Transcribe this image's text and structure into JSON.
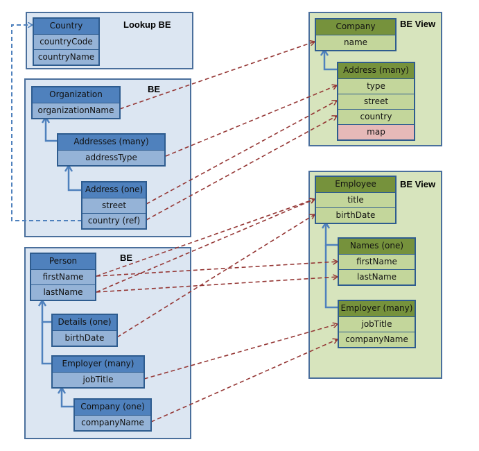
{
  "containers": {
    "lookup": {
      "title": "Lookup BE"
    },
    "org": {
      "title": "BE"
    },
    "person": {
      "title": "BE"
    },
    "company_view": {
      "title": "BE View"
    },
    "employee_view": {
      "title": "BE View"
    }
  },
  "entities": {
    "country": {
      "header": "Country",
      "fields": [
        "countryCode",
        "countryName"
      ]
    },
    "organization": {
      "header": "Organization",
      "fields": [
        "organizationName"
      ]
    },
    "addresses": {
      "header": "Addresses (many)",
      "fields": [
        "addressType"
      ]
    },
    "address_one": {
      "header": "Address (one)",
      "fields": [
        "street",
        "country (ref)"
      ]
    },
    "person": {
      "header": "Person",
      "fields": [
        "firstName",
        "lastName"
      ]
    },
    "details": {
      "header": "Details (one)",
      "fields": [
        "birthDate"
      ]
    },
    "employer": {
      "header": "Employer (many)",
      "fields": [
        "jobTitle"
      ]
    },
    "company_one": {
      "header": "Company (one)",
      "fields": [
        "companyName"
      ]
    },
    "v_company": {
      "header": "Company",
      "fields": [
        "name"
      ]
    },
    "v_address": {
      "header": "Address (many)",
      "fields": [
        "type",
        "street",
        "country",
        "map"
      ]
    },
    "v_employee": {
      "header": "Employee",
      "fields": [
        "title",
        "birthDate"
      ]
    },
    "v_names": {
      "header": "Names (one)",
      "fields": [
        "firstName",
        "lastName"
      ]
    },
    "v_employer": {
      "header": "Employer (many)",
      "fields": [
        "jobTitle",
        "companyName"
      ]
    }
  },
  "colors": {
    "be_background": "#dce6f2",
    "view_background": "#d7e4bd",
    "be_header": "#4f81bd",
    "be_field": "#95b3d7",
    "view_header": "#76923c",
    "view_field": "#c3d69b",
    "unmapped_field": "#e6b9b8",
    "mapping_line": "#953735",
    "reference_line": "#4f81bd"
  },
  "mappings": [
    {
      "from": "organization.organizationName",
      "to": "v_company.name"
    },
    {
      "from": "addresses.addressType",
      "to": "v_address.type"
    },
    {
      "from": "address_one.street",
      "to": "v_address.street"
    },
    {
      "from": "address_one.country (ref)",
      "to": "v_address.country"
    },
    {
      "from": "person.firstName",
      "to": "v_employee.title"
    },
    {
      "from": "person.lastName",
      "to": "v_employee.title"
    },
    {
      "from": "person.firstName",
      "to": "v_names.firstName"
    },
    {
      "from": "person.lastName",
      "to": "v_names.lastName"
    },
    {
      "from": "details.birthDate",
      "to": "v_employee.birthDate"
    },
    {
      "from": "employer.jobTitle",
      "to": "v_employer.jobTitle"
    },
    {
      "from": "company_one.companyName",
      "to": "v_employer.companyName"
    }
  ],
  "references": [
    {
      "from": "address_one.country (ref)",
      "to": "country"
    }
  ]
}
